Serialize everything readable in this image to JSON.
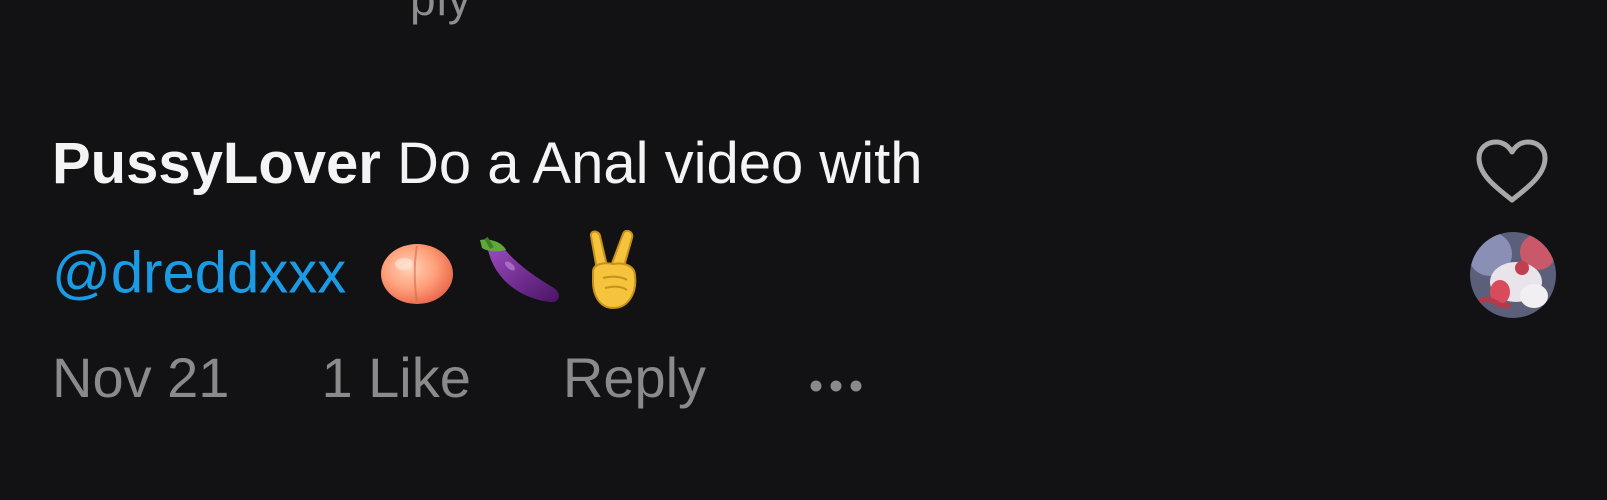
{
  "previous_comment": {
    "fragment": "ply"
  },
  "comment": {
    "username": "PussyLover",
    "text": "Do a Anal video with",
    "mention": "@dreddxxx",
    "emojis": [
      "peach-emoji",
      "eggplant-emoji",
      "victory-hand-emoji"
    ],
    "date": "Nov 21",
    "likes": "1 Like",
    "reply_label": "Reply",
    "more_icon": "more-horizontal-icon",
    "like_icon": "heart-outline-icon"
  },
  "colors": {
    "background": "#121214",
    "mention": "#1a9be6",
    "meta": "#8a8a8a",
    "text": "#f4f4f4"
  }
}
